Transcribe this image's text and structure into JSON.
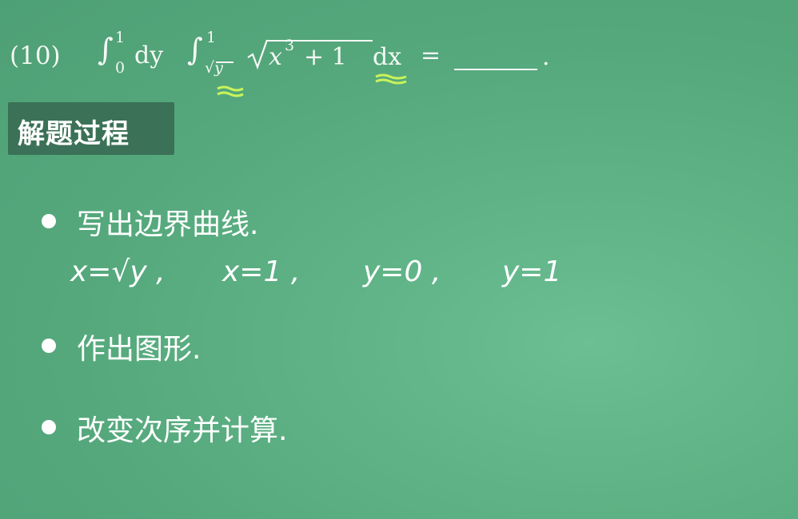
{
  "problem": {
    "number": "(10)",
    "formula": {
      "int1": "∫",
      "int1_lower": "0",
      "int1_upper": "1",
      "dy": "dy",
      "int2": "∫",
      "int2_lower": "√y",
      "int2_upper": "1",
      "radicand_x": "x",
      "radicand_exp": "3",
      "radicand_rest": "+ 1",
      "dx": "dx",
      "equals": "=",
      "period": "."
    }
  },
  "section_label": "解题过程",
  "steps": [
    {
      "text": "写出边界曲线."
    },
    {
      "text": "作出图形."
    },
    {
      "text": "改变次序并计算."
    }
  ],
  "handwritten_boundaries": [
    "x=√y ,",
    "x=1 ,",
    "y=0 ,",
    "y=1"
  ],
  "colors": {
    "board": "#5fb386",
    "label_bg": "#3b7156",
    "highlight": "#c9f35a"
  }
}
